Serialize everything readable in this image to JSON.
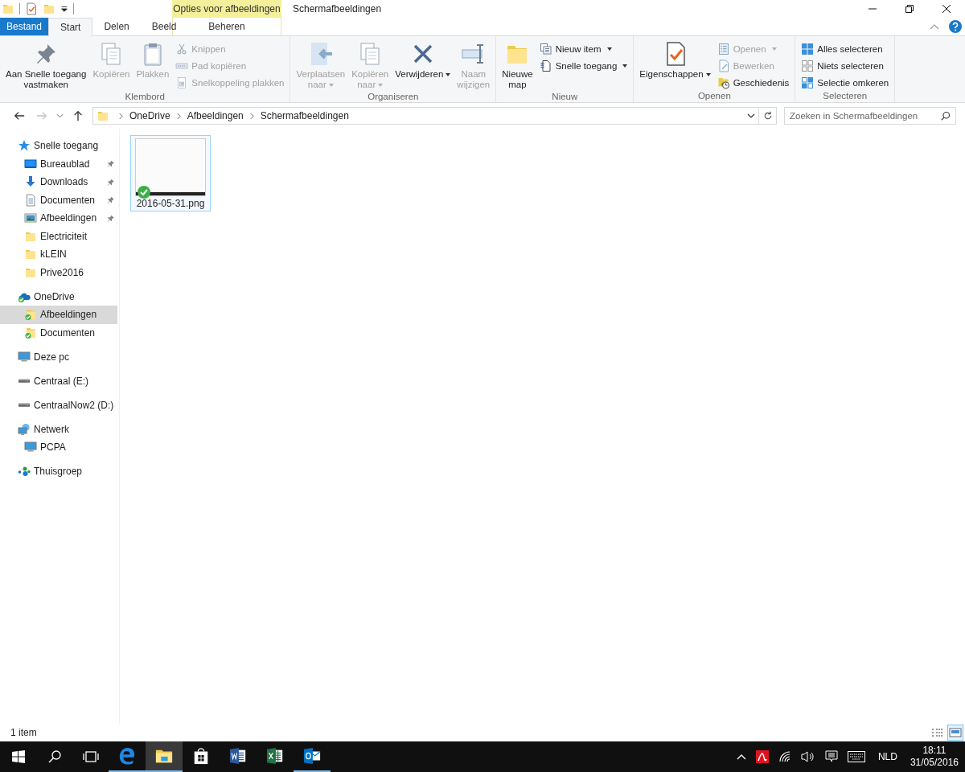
{
  "window": {
    "title": "Schermafbeeldingen",
    "context_group": "Opties voor afbeeldingen"
  },
  "ribbon_tabs": [
    {
      "label": "Bestand",
      "kind": "file",
      "selected": false
    },
    {
      "label": "Start",
      "kind": "tab",
      "selected": true
    },
    {
      "label": "Delen",
      "kind": "tab",
      "selected": false
    },
    {
      "label": "Beeld",
      "kind": "tab",
      "selected": false
    },
    {
      "label": "Beheren",
      "kind": "context",
      "selected": false
    }
  ],
  "ribbon_groups": [
    {
      "label": "Klembord",
      "commands": [
        {
          "label": "Aan Snelle toegang\nvastmaken",
          "kind": "large",
          "disabled": false,
          "dropdown": false
        },
        {
          "label": "Kopiëren",
          "kind": "large",
          "disabled": true,
          "dropdown": false
        },
        {
          "label": "Plakken",
          "kind": "large",
          "disabled": true,
          "dropdown": false
        },
        {
          "label": "Knippen",
          "kind": "small",
          "disabled": true,
          "dropdown": false
        },
        {
          "label": "Pad kopiëren",
          "kind": "small",
          "disabled": true,
          "dropdown": false
        },
        {
          "label": "Snelkoppeling plakken",
          "kind": "small",
          "disabled": true,
          "dropdown": false
        }
      ]
    },
    {
      "label": "Organiseren",
      "commands": [
        {
          "label": "Verplaatsen\nnaar",
          "kind": "large",
          "disabled": true,
          "dropdown": true
        },
        {
          "label": "Kopiëren\nnaar",
          "kind": "large",
          "disabled": true,
          "dropdown": true
        },
        {
          "label": "Verwijderen",
          "kind": "large",
          "disabled": false,
          "dropdown": true
        },
        {
          "label": "Naam\nwijzigen",
          "kind": "large",
          "disabled": true,
          "dropdown": false
        }
      ]
    },
    {
      "label": "Nieuw",
      "commands": [
        {
          "label": "Nieuwe\nmap",
          "kind": "large",
          "disabled": false,
          "dropdown": false
        },
        {
          "label": "Nieuw item",
          "kind": "small",
          "disabled": false,
          "dropdown": true
        },
        {
          "label": "Snelle toegang",
          "kind": "small",
          "disabled": false,
          "dropdown": true
        }
      ]
    },
    {
      "label": "Openen",
      "commands": [
        {
          "label": "Eigenschappen",
          "kind": "large",
          "disabled": false,
          "dropdown": true
        },
        {
          "label": "Openen",
          "kind": "small",
          "disabled": true,
          "dropdown": true
        },
        {
          "label": "Bewerken",
          "kind": "small",
          "disabled": true,
          "dropdown": false
        },
        {
          "label": "Geschiedenis",
          "kind": "small",
          "disabled": false,
          "dropdown": false
        }
      ]
    },
    {
      "label": "Selecteren",
      "commands": [
        {
          "label": "Alles selecteren",
          "kind": "small",
          "disabled": false,
          "dropdown": false
        },
        {
          "label": "Niets selecteren",
          "kind": "small",
          "disabled": false,
          "dropdown": false
        },
        {
          "label": "Selectie omkeren",
          "kind": "small",
          "disabled": false,
          "dropdown": false
        }
      ]
    }
  ],
  "address_bar": {
    "breadcrumbs": [
      "OneDrive",
      "Afbeeldingen",
      "Schermafbeeldingen"
    ]
  },
  "search": {
    "placeholder": "Zoeken in Schermafbeeldingen"
  },
  "navigation_pane": [
    {
      "label": "Snelle toegang",
      "kind": "quick-access",
      "selected": false,
      "pinned": false,
      "children": [
        {
          "label": "Bureaublad",
          "kind": "desktop",
          "selected": false,
          "pinned": true
        },
        {
          "label": "Downloads",
          "kind": "downloads",
          "selected": false,
          "pinned": true
        },
        {
          "label": "Documenten",
          "kind": "documents",
          "selected": false,
          "pinned": true
        },
        {
          "label": "Afbeeldingen",
          "kind": "pictures",
          "selected": false,
          "pinned": true
        },
        {
          "label": "Electriciteit",
          "kind": "folder",
          "selected": false,
          "pinned": false
        },
        {
          "label": "kLEIN",
          "kind": "folder",
          "selected": false,
          "pinned": false
        },
        {
          "label": "Prive2016",
          "kind": "folder",
          "selected": false,
          "pinned": false
        }
      ]
    },
    {
      "label": "OneDrive",
      "kind": "onedrive",
      "selected": false,
      "pinned": false,
      "children": [
        {
          "label": "Afbeeldingen",
          "kind": "synced-folder",
          "selected": true,
          "pinned": false
        },
        {
          "label": "Documenten",
          "kind": "synced-folder",
          "selected": false,
          "pinned": false
        }
      ]
    },
    {
      "label": "Deze pc",
      "kind": "pc",
      "selected": false,
      "pinned": false
    },
    {
      "label": "Centraal (E:)",
      "kind": "drive",
      "selected": false,
      "pinned": false
    },
    {
      "label": "CentraalNow2 (D:)",
      "kind": "drive",
      "selected": false,
      "pinned": false
    },
    {
      "label": "Netwerk",
      "kind": "network",
      "selected": false,
      "pinned": false,
      "children": [
        {
          "label": "PCPA",
          "kind": "pc",
          "selected": false,
          "pinned": false
        }
      ]
    },
    {
      "label": "Thuisgroep",
      "kind": "homegroup",
      "selected": false,
      "pinned": false
    }
  ],
  "files": [
    {
      "name": "2016-05-31.png",
      "selected": true,
      "synced": true
    }
  ],
  "status_bar": {
    "item_count": "1 item",
    "views": [
      {
        "kind": "details",
        "selected": false
      },
      {
        "kind": "large-icons",
        "selected": true
      }
    ]
  },
  "taskbar": {
    "apps": [
      {
        "kind": "browser",
        "running": true,
        "active": false
      },
      {
        "kind": "explorer",
        "running": true,
        "active": true
      },
      {
        "kind": "store",
        "running": false,
        "active": false
      },
      {
        "kind": "word",
        "running": false,
        "active": false
      },
      {
        "kind": "excel",
        "running": false,
        "active": false
      },
      {
        "kind": "mail",
        "running": true,
        "active": false
      }
    ],
    "language": "NLD",
    "time": "18:11",
    "date": "31/05/2016"
  }
}
